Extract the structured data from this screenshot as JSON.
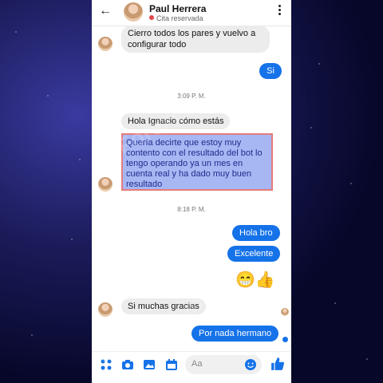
{
  "header": {
    "contact_name": "Paul Herrera",
    "status": "Cita reservada"
  },
  "messages": {
    "m1": "Cierro todos los pares y vuelvo a configurar todo",
    "m2": "Si",
    "time1": "3:09 P. M.",
    "m3": "Hola Ignacio cómo estás",
    "m4": "Quería decirte que estoy muy contento con el resultado del bot lo tengo operando ya un mes en cuenta real y ha dado muy buen resultado",
    "time2": "8:18 P. M.",
    "m5": "Hola bro",
    "m6": "Excelente",
    "emoji": "😁👍",
    "m7": "Si muchas gracias",
    "m8": "Por nada hermano"
  },
  "composer": {
    "placeholder": "Aa"
  },
  "watermark": "@ForexLiberty",
  "colors": {
    "accent": "#1572e8",
    "highlight": "#a7b7f3",
    "highlight_border": "#e57b7b"
  }
}
